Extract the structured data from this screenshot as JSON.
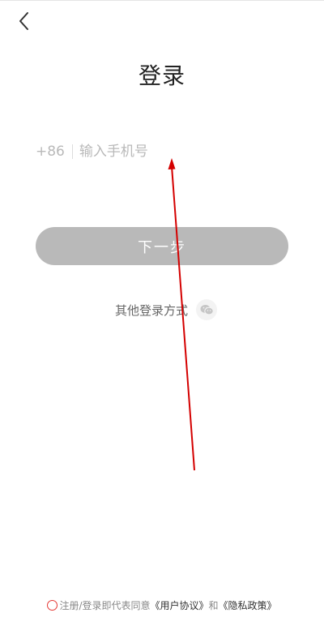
{
  "header": {
    "back_icon": "chevron-left-icon",
    "title": "登录"
  },
  "form": {
    "country_code": "+86",
    "phone_placeholder": "输入手机号",
    "phone_value": "",
    "next_label": "下一步"
  },
  "other_login": {
    "label": "其他登录方式",
    "wechat_icon": "wechat-icon"
  },
  "agreement": {
    "prefix": "注册/登录即代表同意",
    "user_agreement": "《用户协议》",
    "conjunction": "和",
    "privacy_policy": "《隐私政策》",
    "checkbox_color": "#e53935"
  },
  "colors": {
    "button_disabled": "#b9b9b9",
    "swipe_arrow": "#d40000"
  }
}
